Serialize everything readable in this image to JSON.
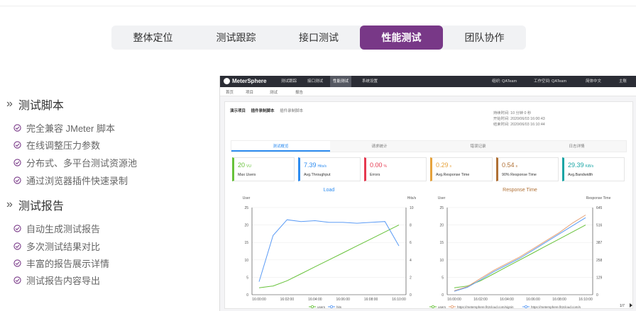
{
  "tabs": [
    "整体定位",
    "测试跟踪",
    "接口测试",
    "性能测试",
    "团队协作"
  ],
  "active_tab": "性能测试",
  "section_script": {
    "title": "测试脚本",
    "items": [
      "完全兼容 JMeter 脚本",
      "在线调整压力参数",
      "分布式、多平台测试资源池",
      "通过浏览器插件快速录制"
    ]
  },
  "section_report": {
    "title": "测试报告",
    "items": [
      "自动生成测试报告",
      "多次测试结果对比",
      "丰富的报告展示详情",
      "测试报告内容导出"
    ]
  },
  "colors": {
    "accent": "#783887",
    "check": "#783887",
    "blue": "#2d8cf0",
    "green": "#67c23a"
  },
  "app": {
    "logo": "MeterSphere",
    "nav": [
      "测试跟踪",
      "接口测试",
      "性能测试",
      "系统设置"
    ],
    "nav_active": "性能测试",
    "org": "组织: QATeam",
    "workspace": "工作空间: QATeam",
    "lang": "简体中文",
    "user": "主账",
    "subnav": [
      "首页",
      "项目",
      "测试",
      "报告"
    ],
    "crumbs": [
      "演示项目",
      "插件录制脚本",
      "插件录制脚本"
    ],
    "meta": [
      "持续时间: 10 分钟 0 秒",
      "开始时间: 2020/06/03 16:00:43",
      "结束时间: 2020/06/03 16:10:44"
    ],
    "inner_tabs": [
      "测试概览",
      "请求统计",
      "错误记录",
      "日志详情"
    ],
    "inner_active": "测试概览",
    "stats": [
      {
        "value": "20",
        "unit": "VU",
        "label": "Max Users",
        "color": "#67c23a"
      },
      {
        "value": "7.39",
        "unit": "Hits/s",
        "label": "Avg.Throughput",
        "color": "#2d8cf0"
      },
      {
        "value": "0.00",
        "unit": "%",
        "label": "Errors",
        "color": "#e6384f"
      },
      {
        "value": "0.29",
        "unit": "s",
        "label": "Avg.Response Time",
        "color": "#e6a23c"
      },
      {
        "value": "0.54",
        "unit": "s",
        "label": "90% Response Time",
        "color": "#b07035"
      },
      {
        "value": "29.39",
        "unit": "KiB/s",
        "label": "Avg.Bandwidth",
        "color": "#17a5a5"
      }
    ]
  },
  "chart_data": [
    {
      "type": "line",
      "title": "Load",
      "ylabel": "User",
      "y2label": "Hits/s",
      "x": [
        "16:00:00",
        "16:02:00",
        "16:04:00",
        "16:06:00",
        "16:08:00",
        "16:10:00"
      ],
      "ylim": [
        0,
        25
      ],
      "y2lim": [
        0,
        10
      ],
      "series": [
        {
          "name": "users",
          "color": "#67c23a",
          "values": [
            2,
            2.5,
            4,
            6,
            8,
            10,
            12,
            14,
            16,
            18,
            20
          ]
        },
        {
          "name": "hits",
          "color": "#5b9bf5",
          "values": [
            1.5,
            6.8,
            8.6,
            8.4,
            8.5,
            8.3,
            8.3,
            8.2,
            8.3,
            8.4,
            5.6
          ]
        }
      ]
    },
    {
      "type": "line",
      "title": "Response Time",
      "ylabel": "User",
      "y2label": "Response Time",
      "x": [
        "16:00:00",
        "16:02:00",
        "16:04:00",
        "16:06:00",
        "16:08:00",
        "16:10:00"
      ],
      "ylim": [
        0,
        25
      ],
      "y2lim": [
        0,
        645
      ],
      "y2ticks": [
        "0",
        "129",
        "258",
        "387",
        "516",
        "645"
      ],
      "series": [
        {
          "name": "users",
          "color": "#67c23a",
          "values": [
            2,
            2.5,
            4,
            6,
            8,
            10,
            12,
            14,
            16,
            18,
            20
          ]
        },
        {
          "name": "https://metersphere.fit2cloud.com/signin",
          "color": "#e6a074",
          "values": [
            30,
            60,
            120,
            180,
            230,
            280,
            340,
            400,
            460,
            530,
            590
          ]
        },
        {
          "name": "https://metersphere.fit2cloud.com/s",
          "color": "#5b9bf5",
          "values": [
            25,
            55,
            110,
            170,
            220,
            270,
            330,
            390,
            450,
            510,
            570
          ]
        }
      ]
    }
  ],
  "legend_page": "1/7"
}
